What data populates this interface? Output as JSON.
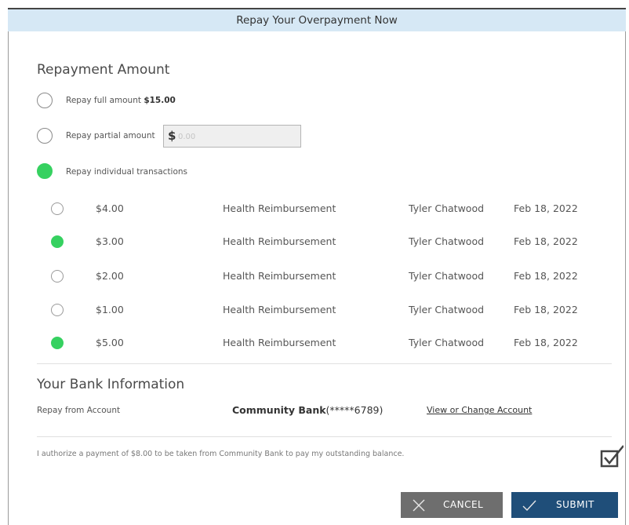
{
  "dialog": {
    "title": "Repay Your Overpayment Now"
  },
  "repayment": {
    "heading": "Repayment Amount",
    "options": {
      "full": {
        "label": "Repay full amount ",
        "amount": "$15.00",
        "selected": false
      },
      "partial": {
        "label": "Repay partial amount",
        "currency": "$",
        "placeholder": "0.00",
        "selected": false
      },
      "individual": {
        "label": "Repay individual transactions",
        "selected": true
      }
    },
    "transactions": [
      {
        "amount": "$4.00",
        "type": "Health Reimbursement",
        "name": "Tyler Chatwood",
        "date": "Feb 18, 2022",
        "selected": false
      },
      {
        "amount": "$3.00",
        "type": "Health Reimbursement",
        "name": "Tyler Chatwood",
        "date": "Feb 18, 2022",
        "selected": true
      },
      {
        "amount": "$2.00",
        "type": "Health Reimbursement",
        "name": "Tyler Chatwood",
        "date": "Feb 18, 2022",
        "selected": false
      },
      {
        "amount": "$1.00",
        "type": "Health Reimbursement",
        "name": "Tyler Chatwood",
        "date": "Feb 18, 2022",
        "selected": false
      },
      {
        "amount": "$5.00",
        "type": "Health Reimbursement",
        "name": "Tyler Chatwood",
        "date": "Feb 18, 2022",
        "selected": true
      }
    ]
  },
  "bank": {
    "heading": "Your Bank Information",
    "label": "Repay from Account",
    "bank_name": "Community Bank",
    "account_mask": "(*****6789)",
    "change_link": "View or Change Account"
  },
  "authorization": {
    "text": "I authorize a payment of $8.00 to be taken from Community Bank to pay my outstanding balance.",
    "checked": true
  },
  "actions": {
    "cancel_label": "CANCEL",
    "submit_label": "SUBMIT"
  },
  "colors": {
    "accent_green": "#36d160",
    "submit_blue": "#1f4e79",
    "cancel_gray": "#6e6e6e",
    "header_blue": "#d6e8f5"
  },
  "icons": {
    "cancel": "x-icon",
    "submit": "check-icon",
    "authorization": "checkbox-checked-icon"
  }
}
